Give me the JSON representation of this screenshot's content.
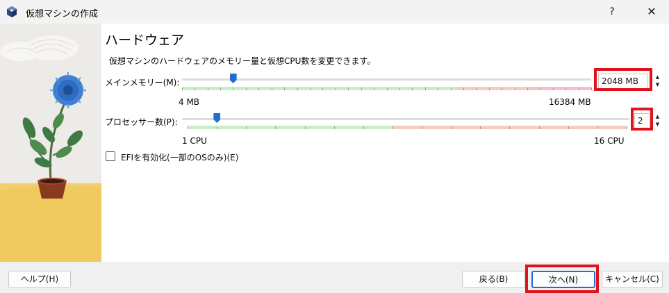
{
  "window": {
    "title": "仮想マシンの作成",
    "help_label": "?",
    "close_label": "✕"
  },
  "page": {
    "title": "ハードウェア",
    "description": "仮想マシンのハードウェアのメモリー量と仮想CPU数を変更できます。"
  },
  "memory": {
    "label": "メインメモリー(M):",
    "value": "2048 MB",
    "min_label": "4 MB",
    "max_label": "16384 MB",
    "slider_fraction": 0.125
  },
  "cpu": {
    "label": "プロセッサー数(P):",
    "value": "2",
    "min_label": "1 CPU",
    "max_label": "16 CPU",
    "slider_fraction": 0.067
  },
  "efi": {
    "label": "EFIを有効化(一部のOSのみ)(E)",
    "checked": false
  },
  "footer": {
    "help_button": "ヘルプ(H)",
    "back_button": "戻る(B)",
    "next_button": "次へ(N)",
    "cancel_button": "キャンセル(C)"
  },
  "colors": {
    "accent": "#1f6fcf",
    "highlight": "#e0131c",
    "safe_zone": "#c8efc4",
    "warn_zone": "#f6cdbf",
    "danger_zone": "#f4c2c8"
  },
  "icons": {
    "app": "virtualbox-cube-icon",
    "help": "question-mark-icon",
    "close": "close-icon",
    "spin_up": "triangle-up-icon",
    "spin_down": "triangle-down-icon"
  }
}
